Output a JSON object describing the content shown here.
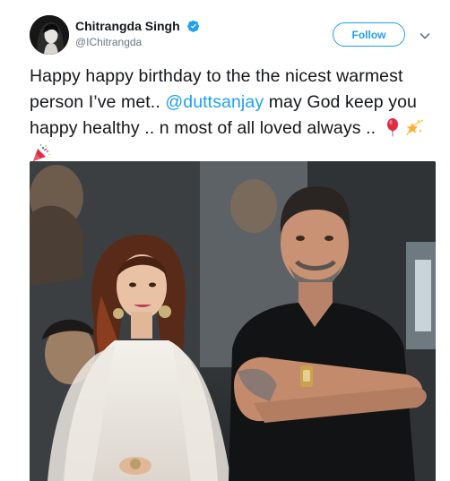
{
  "author": {
    "display_name": "Chitrangda Singh",
    "handle": "@IChitrangda",
    "verified_icon": "verified-badge-icon"
  },
  "actions": {
    "follow_label": "Follow",
    "menu_icon": "chevron-down-icon"
  },
  "tweet": {
    "text_before": "Happy happy birthday to the the nicest warmest person I’ve met.. ",
    "mention": "@duttsanjay",
    "text_after": " may God keep you happy healthy .. n most of all loved always .. ",
    "emojis": [
      "balloon-icon",
      "dizzy-star-icon",
      "party-popper-icon"
    ]
  },
  "colors": {
    "accent": "#1da1f2",
    "text": "#14171a",
    "muted": "#657786"
  }
}
